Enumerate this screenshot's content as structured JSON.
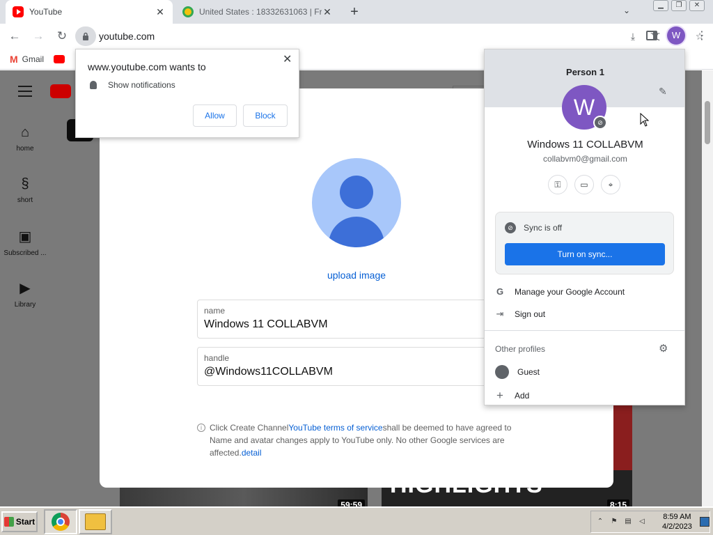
{
  "tabs": [
    {
      "title": "YouTube",
      "close": "✕",
      "favicon": "youtube-icon"
    },
    {
      "title": "United States : 18332631063 | Fr...",
      "close": "✕",
      "favicon": "globe-icon"
    }
  ],
  "toolbar": {
    "url": "youtube.com",
    "new_tab": "+",
    "back": "←",
    "forward": "→",
    "reload": "↻"
  },
  "window_controls": {
    "minimize": "▁",
    "restore": "❐",
    "close": "✕"
  },
  "bookmarks": [
    {
      "label": "Gmail",
      "icon": "gmail-icon"
    },
    {
      "label": "",
      "icon": "youtube-icon"
    }
  ],
  "yt_sidebar": [
    {
      "label": "home",
      "icon": "home-icon",
      "glyph": "⌂"
    },
    {
      "label": "short",
      "icon": "shorts-icon",
      "glyph": "§"
    },
    {
      "label": "Subscribed ...",
      "icon": "subscriptions-icon",
      "glyph": "▣"
    },
    {
      "label": "Library",
      "icon": "library-icon",
      "glyph": "▶"
    }
  ],
  "dialog": {
    "upload_label": "upload image",
    "name_label": "name",
    "name_value": "Windows 11 COLLABVM",
    "handle_label": "handle",
    "handle_value": "@Windows11COLLABVM",
    "notice_pre": "Click Create Channel",
    "notice_link": "YouTube terms of service",
    "notice_post": "shall be deemed to have agreed to Name and avatar changes apply to YouTube only. No other Google services are affected.",
    "notice_detail": "detail",
    "info_glyph": "i"
  },
  "thumbnails": [
    {
      "duration": "59:59"
    },
    {
      "duration": "8:15",
      "text": "HIGHLIGHTS"
    }
  ],
  "notification": {
    "title": "www.youtube.com wants to",
    "permission": "Show notifications",
    "allow": "Allow",
    "block": "Block",
    "close": "✕"
  },
  "profile": {
    "header": "Person 1",
    "avatar_letter": "W",
    "name": "Windows 11 COLLABVM",
    "email": "collabvm0@gmail.com",
    "sync_status": "Sync is off",
    "sync_button": "Turn on sync...",
    "manage_account": "Manage your Google Account",
    "sign_out": "Sign out",
    "other_profiles": "Other profiles",
    "guest": "Guest",
    "add": "Add"
  },
  "taskbar": {
    "start": "Start",
    "time": "8:59 AM",
    "date": "4/2/2023"
  },
  "colors": {
    "accent_blue": "#1a73e8",
    "avatar_purple": "#7e57c2",
    "youtube_red": "#ff0000",
    "link_blue": "#065fd4"
  }
}
